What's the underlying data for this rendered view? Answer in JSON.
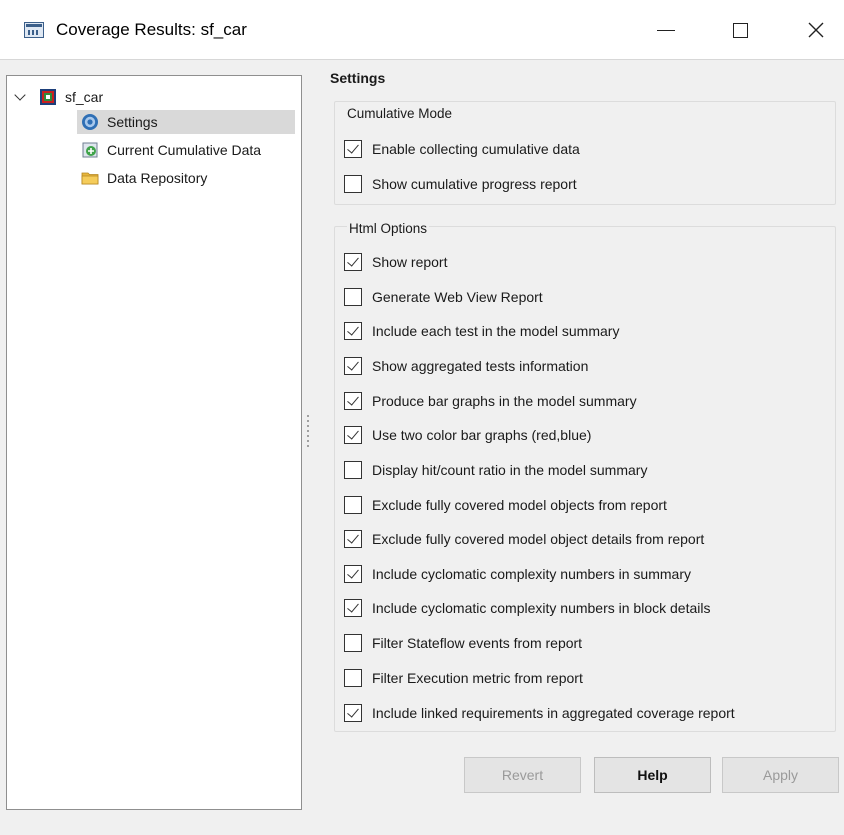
{
  "window": {
    "title": "Coverage Results: sf_car",
    "icon": "app-window-icon"
  },
  "tree": {
    "root": {
      "label": "sf_car",
      "icon": "simulink-model-icon",
      "expanded": true
    },
    "children": [
      {
        "label": "Settings",
        "icon": "settings-gear-icon",
        "selected": true
      },
      {
        "label": "Current Cumulative Data",
        "icon": "cumulative-data-icon",
        "selected": false
      },
      {
        "label": "Data Repository",
        "icon": "folder-icon",
        "selected": false
      }
    ]
  },
  "settings": {
    "title": "Settings",
    "cumulative_mode": {
      "title": "Cumulative Mode",
      "options": [
        {
          "label": "Enable collecting cumulative data",
          "checked": true
        },
        {
          "label": "Show cumulative progress report",
          "checked": false
        }
      ]
    },
    "html_options": {
      "title": "Html Options",
      "options": [
        {
          "label": "Show report",
          "checked": true
        },
        {
          "label": "Generate Web View Report",
          "checked": false
        },
        {
          "label": "Include each test in the model summary",
          "checked": true
        },
        {
          "label": "Show aggregated tests information",
          "checked": true
        },
        {
          "label": "Produce bar graphs in the model summary",
          "checked": true
        },
        {
          "label": "Use two color bar graphs (red,blue)",
          "checked": true
        },
        {
          "label": "Display hit/count ratio in the model summary",
          "checked": false
        },
        {
          "label": "Exclude fully covered model objects from report",
          "checked": false
        },
        {
          "label": "Exclude fully covered model object details from report",
          "checked": true
        },
        {
          "label": "Include cyclomatic complexity numbers in summary",
          "checked": true
        },
        {
          "label": "Include cyclomatic complexity numbers in block details",
          "checked": true
        },
        {
          "label": "Filter Stateflow events from report",
          "checked": false
        },
        {
          "label": "Filter Execution metric from report",
          "checked": false
        },
        {
          "label": "Include linked requirements in aggregated coverage report",
          "checked": true
        }
      ]
    }
  },
  "buttons": {
    "revert": "Revert",
    "help": "Help",
    "apply": "Apply"
  }
}
